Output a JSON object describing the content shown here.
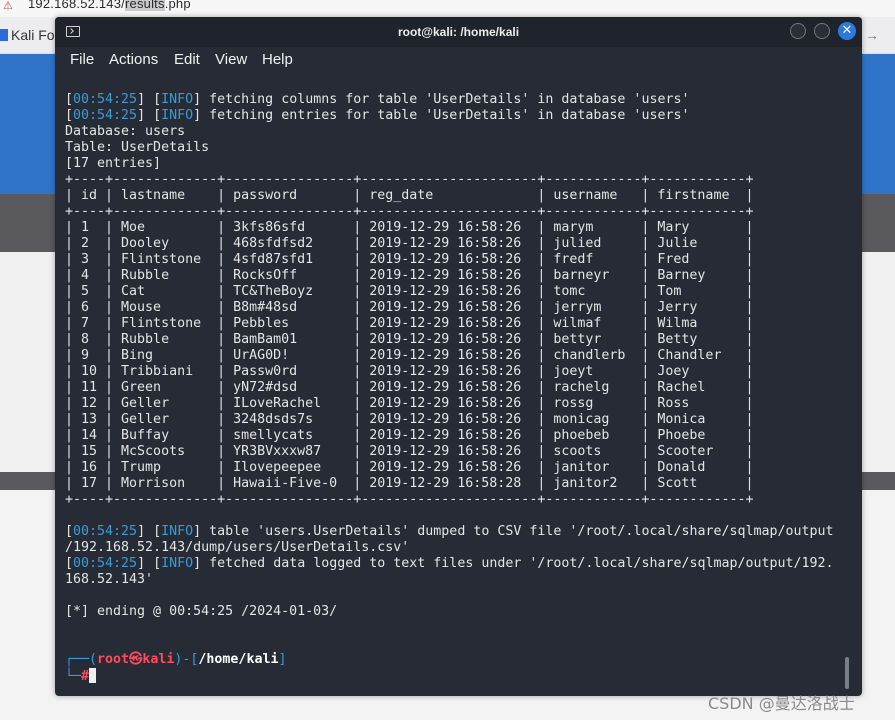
{
  "browser": {
    "url_prefix": "192.168.52.143/",
    "url_selected": "results",
    "url_suffix": ".php",
    "bookmark": "Kali Fo",
    "bookmark_tail": "→"
  },
  "terminal": {
    "title": "root@kali: /home/kali",
    "menu": [
      "File",
      "Actions",
      "Edit",
      "View",
      "Help"
    ],
    "log_top": [
      {
        "time": "00:54:25",
        "level": "INFO",
        "msg": " fetching columns for table 'UserDetails' in database 'users'"
      },
      {
        "time": "00:54:25",
        "level": "INFO",
        "msg": " fetching entries for table 'UserDetails' in database 'users'"
      }
    ],
    "database_line": "Database: users",
    "table_line": "Table: UserDetails",
    "entries_line": "[17 entries]",
    "table": {
      "columns": [
        "id",
        "lastname",
        "password",
        "reg_date",
        "username",
        "firstname"
      ],
      "widths": [
        4,
        13,
        16,
        22,
        12,
        12
      ],
      "rows": [
        [
          "1",
          "Moe",
          "3kfs86sfd",
          "2019-12-29 16:58:26",
          "marym",
          "Mary"
        ],
        [
          "2",
          "Dooley",
          "468sfdfsd2",
          "2019-12-29 16:58:26",
          "julied",
          "Julie"
        ],
        [
          "3",
          "Flintstone",
          "4sfd87sfd1",
          "2019-12-29 16:58:26",
          "fredf",
          "Fred"
        ],
        [
          "4",
          "Rubble",
          "RocksOff",
          "2019-12-29 16:58:26",
          "barneyr",
          "Barney"
        ],
        [
          "5",
          "Cat",
          "TC&TheBoyz",
          "2019-12-29 16:58:26",
          "tomc",
          "Tom"
        ],
        [
          "6",
          "Mouse",
          "B8m#48sd",
          "2019-12-29 16:58:26",
          "jerrym",
          "Jerry"
        ],
        [
          "7",
          "Flintstone",
          "Pebbles",
          "2019-12-29 16:58:26",
          "wilmaf",
          "Wilma"
        ],
        [
          "8",
          "Rubble",
          "BamBam01",
          "2019-12-29 16:58:26",
          "bettyr",
          "Betty"
        ],
        [
          "9",
          "Bing",
          "UrAG0D!",
          "2019-12-29 16:58:26",
          "chandlerb",
          "Chandler"
        ],
        [
          "10",
          "Tribbiani",
          "Passw0rd",
          "2019-12-29 16:58:26",
          "joeyt",
          "Joey"
        ],
        [
          "11",
          "Green",
          "yN72#dsd",
          "2019-12-29 16:58:26",
          "rachelg",
          "Rachel"
        ],
        [
          "12",
          "Geller",
          "ILoveRachel",
          "2019-12-29 16:58:26",
          "rossg",
          "Ross"
        ],
        [
          "13",
          "Geller",
          "3248dsds7s",
          "2019-12-29 16:58:26",
          "monicag",
          "Monica"
        ],
        [
          "14",
          "Buffay",
          "smellycats",
          "2019-12-29 16:58:26",
          "phoebeb",
          "Phoebe"
        ],
        [
          "15",
          "McScoots",
          "YR3BVxxxw87",
          "2019-12-29 16:58:26",
          "scoots",
          "Scooter"
        ],
        [
          "16",
          "Trump",
          "Ilovepeepee",
          "2019-12-29 16:58:26",
          "janitor",
          "Donald"
        ],
        [
          "17",
          "Morrison",
          "Hawaii-Five-0",
          "2019-12-29 16:58:28",
          "janitor2",
          "Scott"
        ]
      ]
    },
    "log_bottom": [
      {
        "time": "00:54:25",
        "level": "INFO",
        "msg": " table 'users.UserDetails' dumped to CSV file '/root/.local/share/sqlmap/output",
        "cont": "/192.168.52.143/dump/users/UserDetails.csv'"
      },
      {
        "time": "00:54:25",
        "level": "INFO",
        "msg": " fetched data logged to text files under '/root/.local/share/sqlmap/output/192.",
        "cont": "168.52.143'"
      }
    ],
    "ending_line": "[*] ending @ 00:54:25 /2024-01-03/",
    "prompt": {
      "open": "┌──(",
      "user": "root㉿kali",
      "mid": ")-[",
      "path": "/home/kali",
      "close": "]",
      "line2_prefix": "└─",
      "symbol": "#"
    }
  },
  "watermark": "CSDN @曼达洛战士"
}
